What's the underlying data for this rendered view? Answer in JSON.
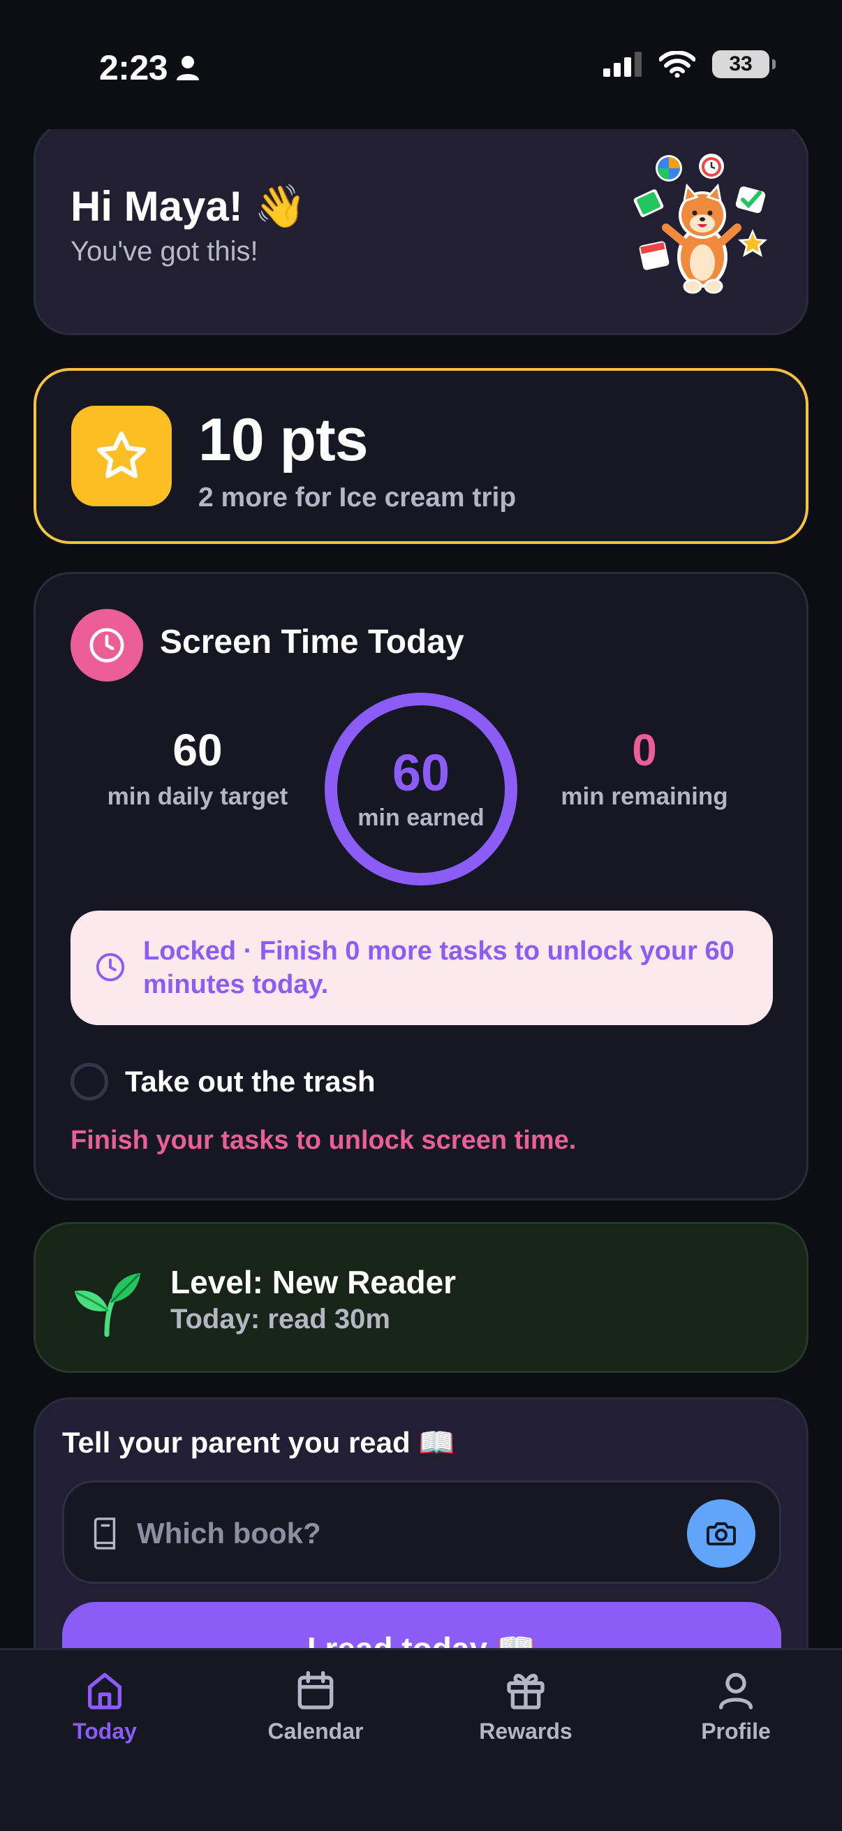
{
  "status_bar": {
    "time": "2:23",
    "battery": "33"
  },
  "greeting": {
    "title": "Hi Maya! 👋",
    "subtitle": "You've got this!"
  },
  "points": {
    "value": "10 pts",
    "subtitle": "2 more for Ice cream trip"
  },
  "screen_time": {
    "title": "Screen Time Today",
    "target_value": "60",
    "target_label": "min daily target",
    "earned_value": "60",
    "earned_label": "min earned",
    "remaining_value": "0",
    "remaining_label": "min remaining",
    "lock_message": "Locked · Finish 0 more tasks to unlock your 60 minutes today.",
    "task_label": "Take out the trash",
    "unlock_hint": "Finish your tasks to unlock screen time."
  },
  "level": {
    "title": "Level: New Reader",
    "subtitle": "Today: read 30m"
  },
  "reading": {
    "title": "Tell your parent you read 📖",
    "book_placeholder": "Which book?",
    "submit_label": "I read today 📖"
  },
  "nav": {
    "items": [
      {
        "label": "Today",
        "icon": "home-icon",
        "active": true
      },
      {
        "label": "Calendar",
        "icon": "calendar-icon"
      },
      {
        "label": "Rewards",
        "icon": "gift-icon"
      },
      {
        "label": "Profile",
        "icon": "person-icon"
      }
    ]
  },
  "colors": {
    "accent": "#8b5cf6",
    "pink": "#ec5f96",
    "gold": "#fbbf24",
    "camera_blue": "#60a5fa",
    "background": "#0c0e14"
  }
}
